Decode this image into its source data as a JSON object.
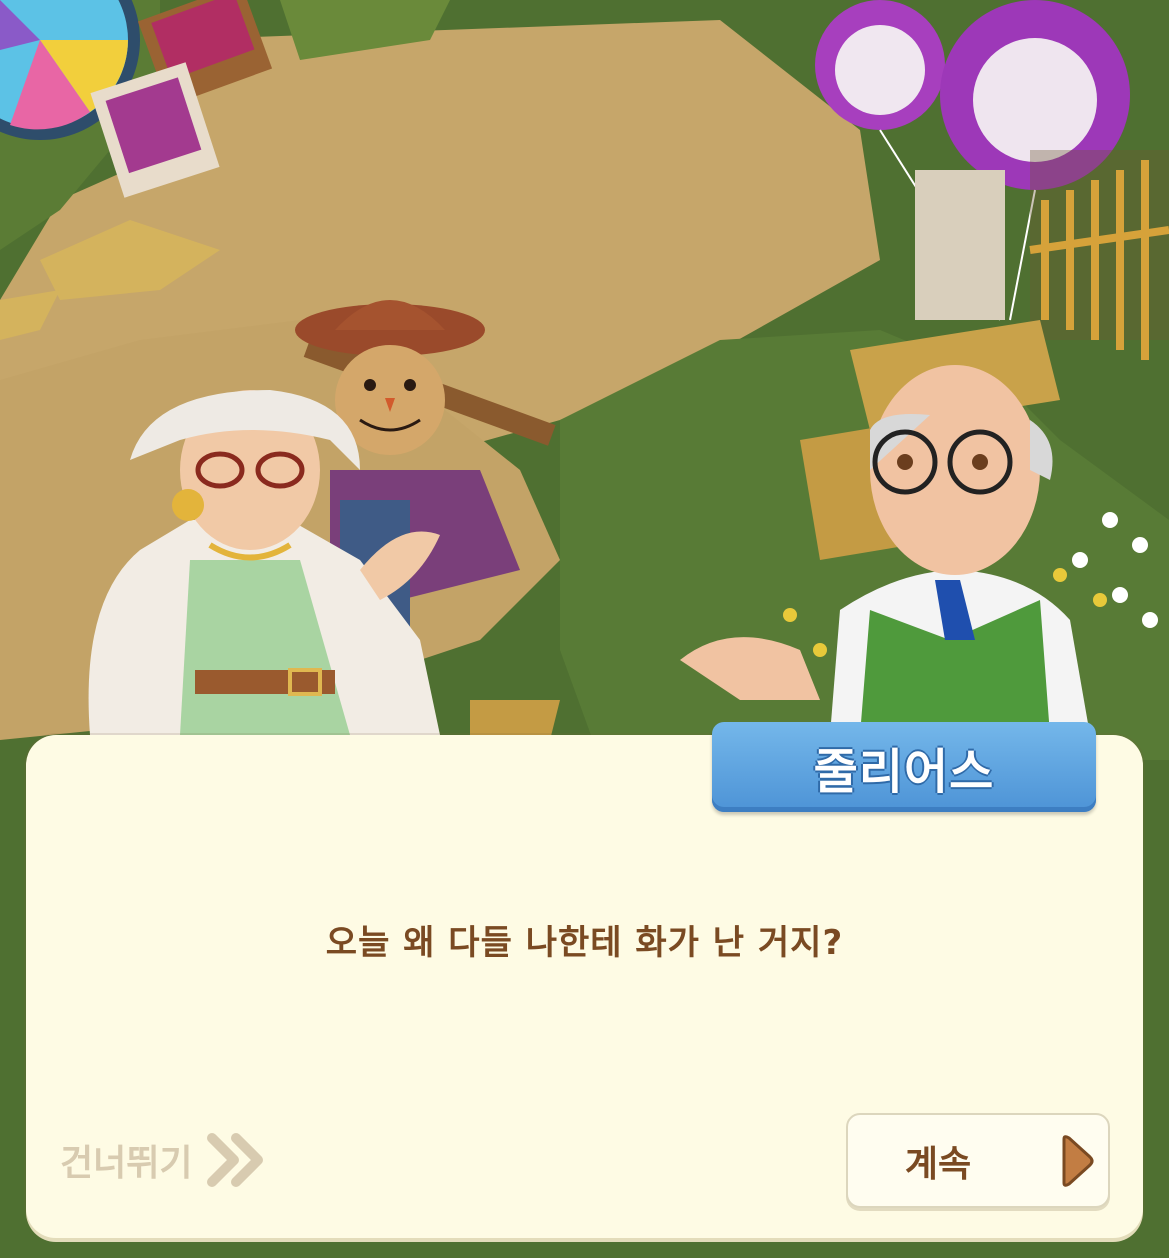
{
  "dialog": {
    "speaker_name": "줄리어스",
    "message": "오늘 왜 다들 나한테 화가 난 거지?"
  },
  "controls": {
    "skip_label": "건너뛰기",
    "skip_icon": "double-chevron-right-icon",
    "continue_label": "계속",
    "continue_icon": "play-triangle-icon"
  },
  "colors": {
    "dialog_bg": "#fefbe4",
    "name_plate": "#5ba3e0",
    "text_brown": "#7a4a22",
    "skip_gray": "#d8cbb0",
    "arrow_brown": "#b7773f"
  }
}
